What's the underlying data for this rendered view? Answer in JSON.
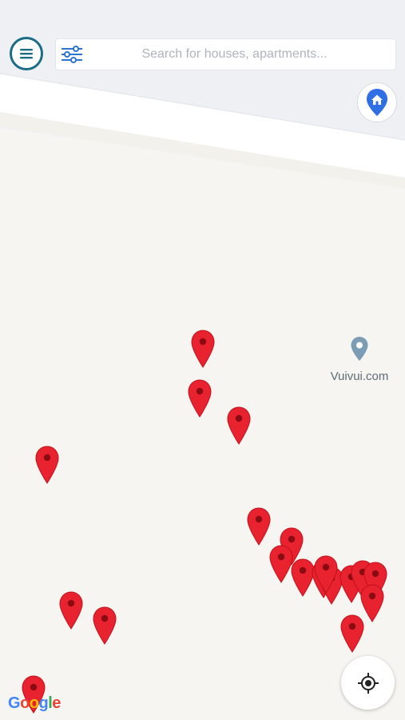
{
  "search": {
    "placeholder": "Search for houses, apartments..."
  },
  "poi": {
    "label": "Vuivui.com"
  },
  "google_logo": {
    "letters": [
      "G",
      "o",
      "o",
      "g",
      "l",
      "e"
    ],
    "colors": [
      "#4285F4",
      "#EA4335",
      "#FBBC05",
      "#4285F4",
      "#34A853",
      "#EA4335"
    ]
  },
  "colors": {
    "marker": "#e8222e",
    "marker_dot": "#8a0c12",
    "accent": "#1b6d86",
    "home_pin": "#2f6fe4",
    "map_background": "#f7f5f1",
    "road": "#ffffff"
  },
  "markers": {
    "count": 19,
    "icon": "map-pin-icon"
  }
}
